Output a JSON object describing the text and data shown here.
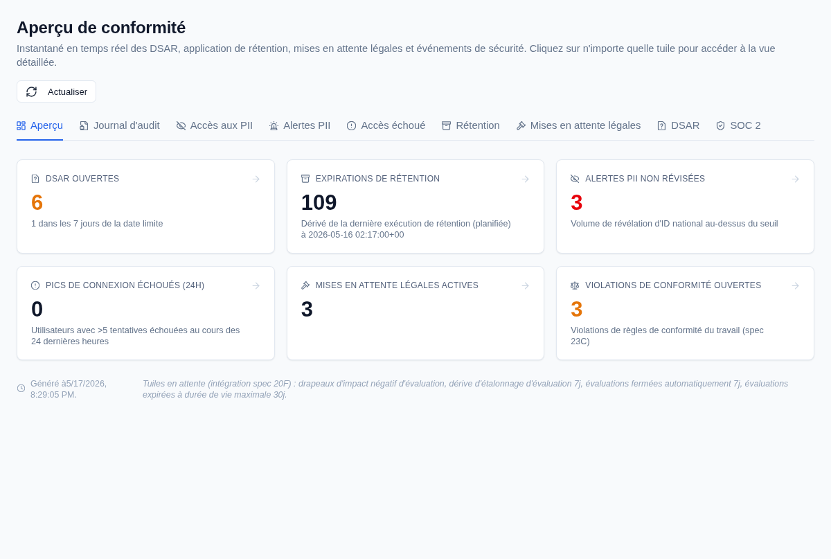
{
  "header": {
    "title": "Aperçu de conformité",
    "subtitle": "Instantané en temps réel des DSAR, application de rétention, mises en attente légales et événements de sécurité. Cliquez sur n'importe quelle tuile pour accéder à la vue détaillée."
  },
  "refresh_button": {
    "label": "Actualiser"
  },
  "tabs": [
    {
      "label": "Aperçu",
      "selected": true
    },
    {
      "label": "Journal d'audit",
      "selected": false
    },
    {
      "label": "Accès aux PII",
      "selected": false
    },
    {
      "label": "Alertes PII",
      "selected": false
    },
    {
      "label": "Accès échoué",
      "selected": false
    },
    {
      "label": "Rétention",
      "selected": false
    },
    {
      "label": "Mises en attente légales",
      "selected": false
    },
    {
      "label": "DSAR",
      "selected": false
    },
    {
      "label": "SOC 2",
      "selected": false
    }
  ],
  "tiles": [
    {
      "label": "DSAR OUVERTES",
      "value": "6",
      "color": "#e57509",
      "description": "1 dans les 7 jours de la date limite"
    },
    {
      "label": "EXPIRATIONS DE RÉTENTION",
      "value": "109",
      "color": "#0f172a",
      "description": "Dérivé de la dernière exécution de rétention (planifiée) à 2026-05-16 02:17:00+00"
    },
    {
      "label": "ALERTES PII NON RÉVISÉES",
      "value": "3",
      "color": "#e7000b",
      "description": "Volume de révélation d'ID national au-dessus du seuil"
    },
    {
      "label": "PICS DE CONNEXION ÉCHOUÉS (24H)",
      "value": "0",
      "color": "#0f172a",
      "description": "Utilisateurs avec >5 tentatives échouées au cours des 24 dernières heures"
    },
    {
      "label": "MISES EN ATTENTE LÉGALES ACTIVES",
      "value": "3",
      "color": "#0f172a"
    },
    {
      "label": "VIOLATIONS DE CONFORMITÉ OUVERTES",
      "value": "3",
      "color": "#e57509",
      "description": "Violations de règles de conformité du travail (spec 23C)"
    }
  ],
  "footer": {
    "generated": "Généré à5/17/2026, 8:29:05 PM.",
    "note": "Tuiles en attente (intégration spec 20F) : drapeaux d'impact négatif d'évaluation, dérive d'étalonnage d'évaluation 7j, évaluations fermées automatiquement 7j, évaluations expirées à durée de vie maximale 30j."
  }
}
